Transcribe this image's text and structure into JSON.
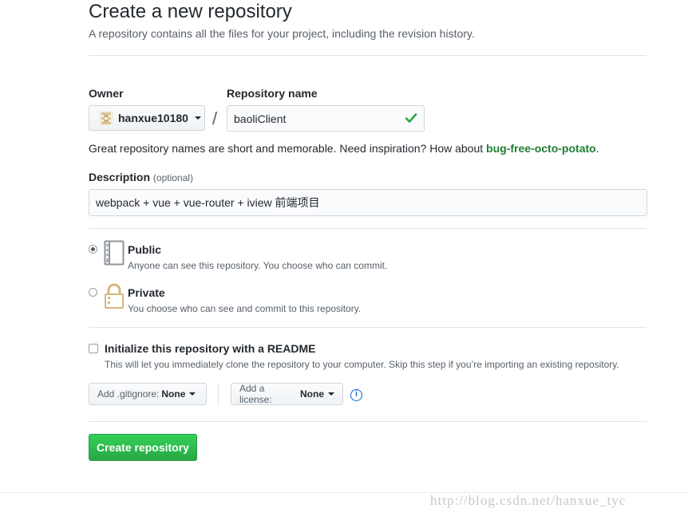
{
  "header": {
    "title": "Create a new repository",
    "subtitle": "A repository contains all the files for your project, including the revision history."
  },
  "owner": {
    "label": "Owner",
    "value": "hanxue10180"
  },
  "separator": "/",
  "repo_name": {
    "label": "Repository name",
    "value": "baoliClient"
  },
  "hint": {
    "text": "Great repository names are short and memorable. Need inspiration? How about ",
    "suggestion": "bug-free-octo-potato",
    "end": "."
  },
  "description": {
    "label": "Description",
    "optional": "(optional)",
    "value": "webpack + vue + vue-router + iview 前端项目"
  },
  "visibility": {
    "selected": "public",
    "options": [
      {
        "id": "public",
        "title": "Public",
        "desc": "Anyone can see this repository. You choose who can commit."
      },
      {
        "id": "private",
        "title": "Private",
        "desc": "You choose who can see and commit to this repository."
      }
    ]
  },
  "readme": {
    "checked": false,
    "title": "Initialize this repository with a README",
    "desc": "This will let you immediately clone the repository to your computer. Skip this step if you’re importing an existing repository."
  },
  "gitignore": {
    "label": "Add .gitignore:",
    "value": "None"
  },
  "license": {
    "label": "Add a license:",
    "value": "None"
  },
  "info_icon": {
    "glyph": "i"
  },
  "submit": {
    "label": "Create repository"
  },
  "watermark": "http://blog.csdn.net/hanxue_tyc",
  "colors": {
    "success": "#28a745",
    "link": "#0366d6"
  }
}
